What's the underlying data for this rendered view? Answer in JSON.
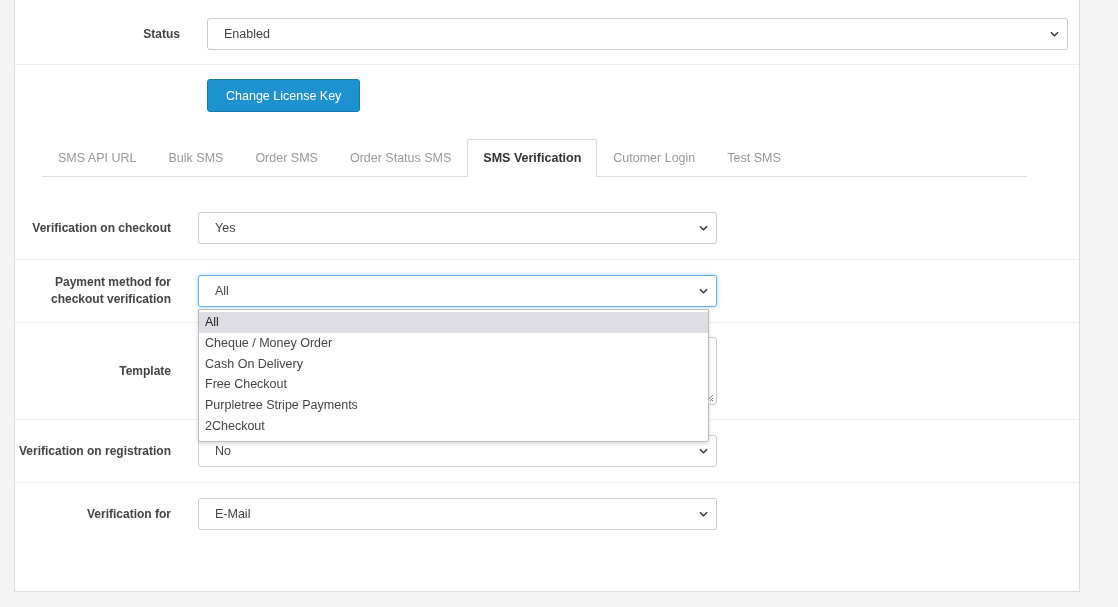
{
  "status_row": {
    "label": "Status",
    "value": "Enabled"
  },
  "license_button": {
    "label": "Change License Key"
  },
  "tabs": [
    {
      "label": "SMS API URL",
      "selected": false
    },
    {
      "label": "Bulk SMS",
      "selected": false
    },
    {
      "label": "Order SMS",
      "selected": false
    },
    {
      "label": "Order Status SMS",
      "selected": false
    },
    {
      "label": "SMS Verification",
      "selected": true
    },
    {
      "label": "Cutomer Login",
      "selected": false
    },
    {
      "label": "Test SMS",
      "selected": false
    }
  ],
  "fields": [
    {
      "kind": "select",
      "label": "Verification on checkout",
      "value": "Yes",
      "focused": false
    },
    {
      "kind": "select",
      "label": "Payment method for checkout verification",
      "value": "All",
      "focused": true,
      "options": [
        {
          "label": "All",
          "selected": true
        },
        {
          "label": "Cheque / Money Order",
          "selected": false
        },
        {
          "label": "Cash On Delivery",
          "selected": false
        },
        {
          "label": "Free Checkout",
          "selected": false
        },
        {
          "label": "Purpletree Stripe Payments",
          "selected": false
        },
        {
          "label": "2Checkout",
          "selected": false
        }
      ]
    },
    {
      "kind": "textarea",
      "label": "Template"
    },
    {
      "kind": "select",
      "label": "Verification on registration",
      "value": "No",
      "focused": false
    },
    {
      "kind": "select",
      "label": "Verification for",
      "value": "E-Mail",
      "focused": false
    }
  ]
}
